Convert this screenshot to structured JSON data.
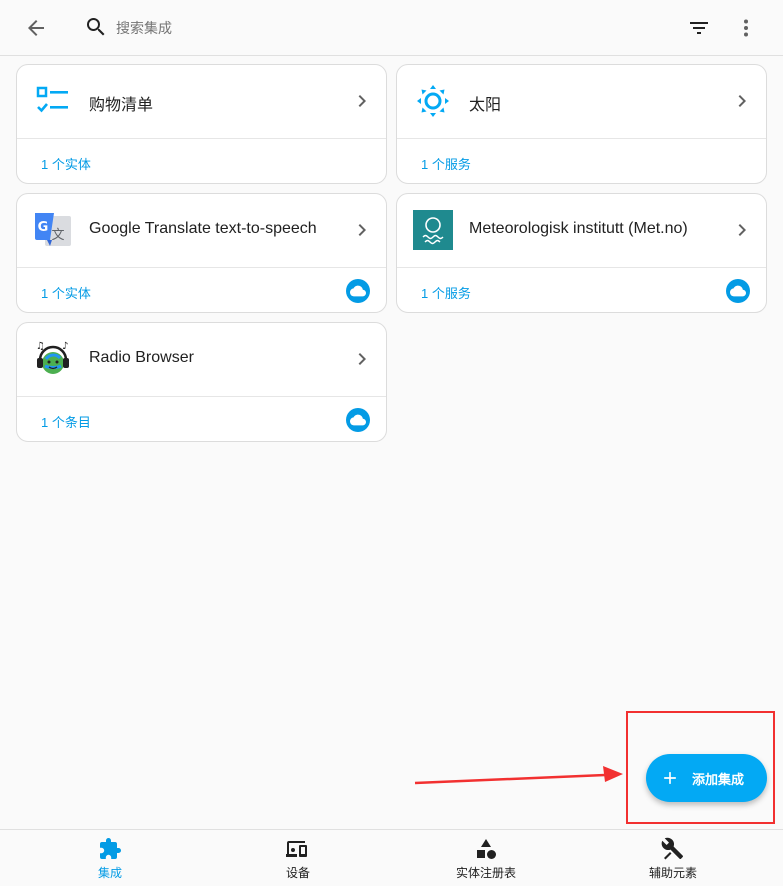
{
  "header": {
    "search_placeholder": "搜索集成"
  },
  "integrations": [
    {
      "title": "购物清单",
      "link": "1 个实体",
      "cloud": false,
      "logo": "checklist-icon"
    },
    {
      "title": "太阳",
      "link": "1 个服务",
      "cloud": false,
      "logo": "sun-icon"
    },
    {
      "title": "Google Translate text-to-speech",
      "link": "1 个实体",
      "cloud": true,
      "logo": "google-translate-icon"
    },
    {
      "title": "Meteorologisk institutt (Met.no)",
      "link": "1 个服务",
      "cloud": true,
      "logo": "met-no-icon"
    },
    {
      "title": "Radio Browser",
      "link": "1 个条目",
      "cloud": true,
      "logo": "radio-browser-icon"
    }
  ],
  "fab": {
    "label": "添加集成"
  },
  "bottom_nav": [
    {
      "label": "集成",
      "icon": "puzzle-icon",
      "active": true
    },
    {
      "label": "设备",
      "icon": "devices-icon",
      "active": false
    },
    {
      "label": "实体注册表",
      "icon": "shapes-icon",
      "active": false
    },
    {
      "label": "辅助元素",
      "icon": "tools-icon",
      "active": false
    }
  ],
  "colors": {
    "accent": "#03a9f4",
    "link": "#039be5",
    "annotation": "#f23030"
  }
}
